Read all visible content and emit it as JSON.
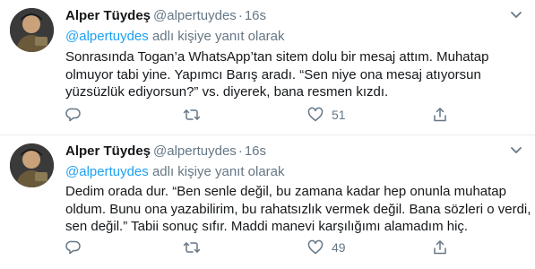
{
  "tweets": [
    {
      "name": "Alper Tüydeş",
      "handle": "@alpertuydes",
      "separator": "·",
      "time": "16s",
      "reply_mention": "@alpertuydes",
      "reply_suffix": "adlı kişiye yanıt olarak",
      "body": "Sonrasında Togan’a WhatsApp’tan sitem dolu bir mesaj attım. Muhatap olmuyor tabi yine. Yapımcı Barış aradı. “Sen niye ona mesaj atıyorsun yüzsüzlük ediyorsun?” vs. diyerek, bana resmen kızdı.",
      "actions": {
        "reply_icon": "reply-icon",
        "retweet_icon": "retweet-icon",
        "like_icon": "heart-icon",
        "like_count": "51",
        "share_icon": "share-icon"
      }
    },
    {
      "name": "Alper Tüydeş",
      "handle": "@alpertuydes",
      "separator": "·",
      "time": "16s",
      "reply_mention": "@alpertuydes",
      "reply_suffix": "adlı kişiye yanıt olarak",
      "body": "Dedim orada dur. “Ben senle değil, bu zamana kadar hep onunla muhatap oldum. Bunu ona yazabilirim, bu rahatsızlık vermek değil. Bana sözleri o verdi, sen değil.” Tabii sonuç sıfır. Maddi manevi karşılığımı alamadım hiç.",
      "actions": {
        "reply_icon": "reply-icon",
        "retweet_icon": "retweet-icon",
        "like_icon": "heart-icon",
        "like_count": "49",
        "share_icon": "share-icon"
      }
    }
  ],
  "colors": {
    "text": "#14171a",
    "muted": "#657786",
    "link": "#1da1f2",
    "divider": "#e6ecf0"
  }
}
